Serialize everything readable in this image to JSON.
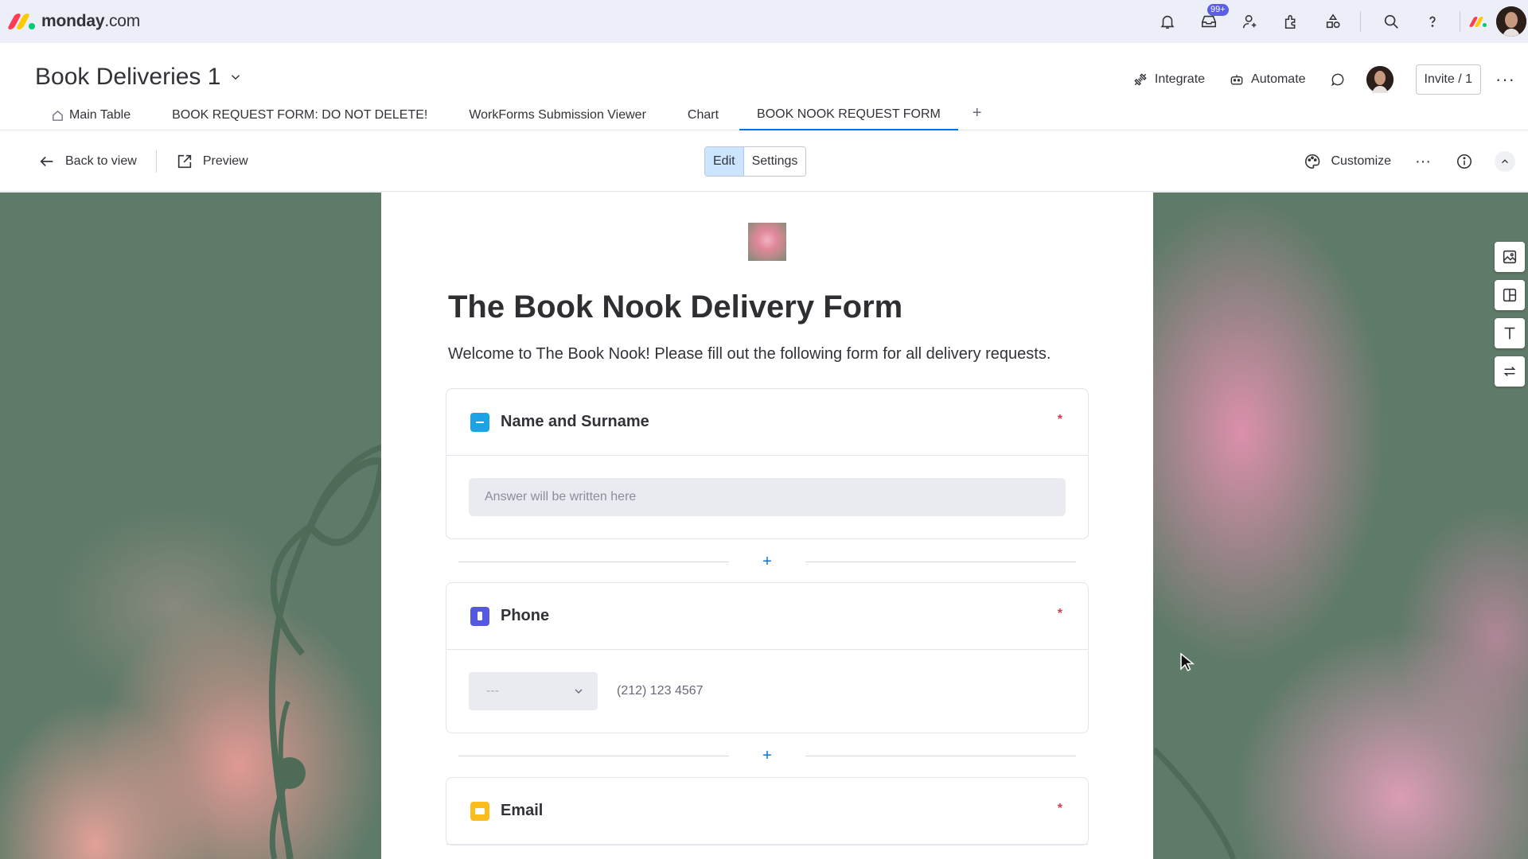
{
  "app": {
    "logo_bold": "monday",
    "logo_light": ".com",
    "brand_colors": [
      "#ff3d57",
      "#ffcb00",
      "#00ca72"
    ],
    "notification_badge": "99+"
  },
  "board": {
    "title": "Book Deliveries 1",
    "integrate_label": "Integrate",
    "automate_label": "Automate",
    "invite_label": "Invite / 1"
  },
  "tabs": [
    {
      "label": "Main Table"
    },
    {
      "label": "BOOK REQUEST FORM: DO NOT DELETE!"
    },
    {
      "label": "WorkForms Submission Viewer"
    },
    {
      "label": "Chart"
    },
    {
      "label": "BOOK NOOK REQUEST FORM"
    }
  ],
  "tab_add": "+",
  "toolbar": {
    "back_label": "Back to view",
    "preview_label": "Preview",
    "edit_label": "Edit",
    "settings_label": "Settings",
    "customize_label": "Customize"
  },
  "form": {
    "title": "The Book Nook Delivery Form",
    "description": "Welcome to The Book Nook! Please fill out the following form for all delivery requests.",
    "questions": [
      {
        "label": "Name and Surname",
        "icon": "text-column-icon",
        "color": "#1ca3e6",
        "required_mark": "*",
        "placeholder": "Answer will be written here"
      },
      {
        "label": "Phone",
        "icon": "phone-column-icon",
        "color": "#5559df",
        "required_mark": "*",
        "country_placeholder": "---",
        "number_placeholder": "(212) 123 4567"
      },
      {
        "label": "Email",
        "icon": "email-column-icon",
        "color": "#fdbc1e",
        "required_mark": "*"
      }
    ],
    "add_question": "+"
  }
}
